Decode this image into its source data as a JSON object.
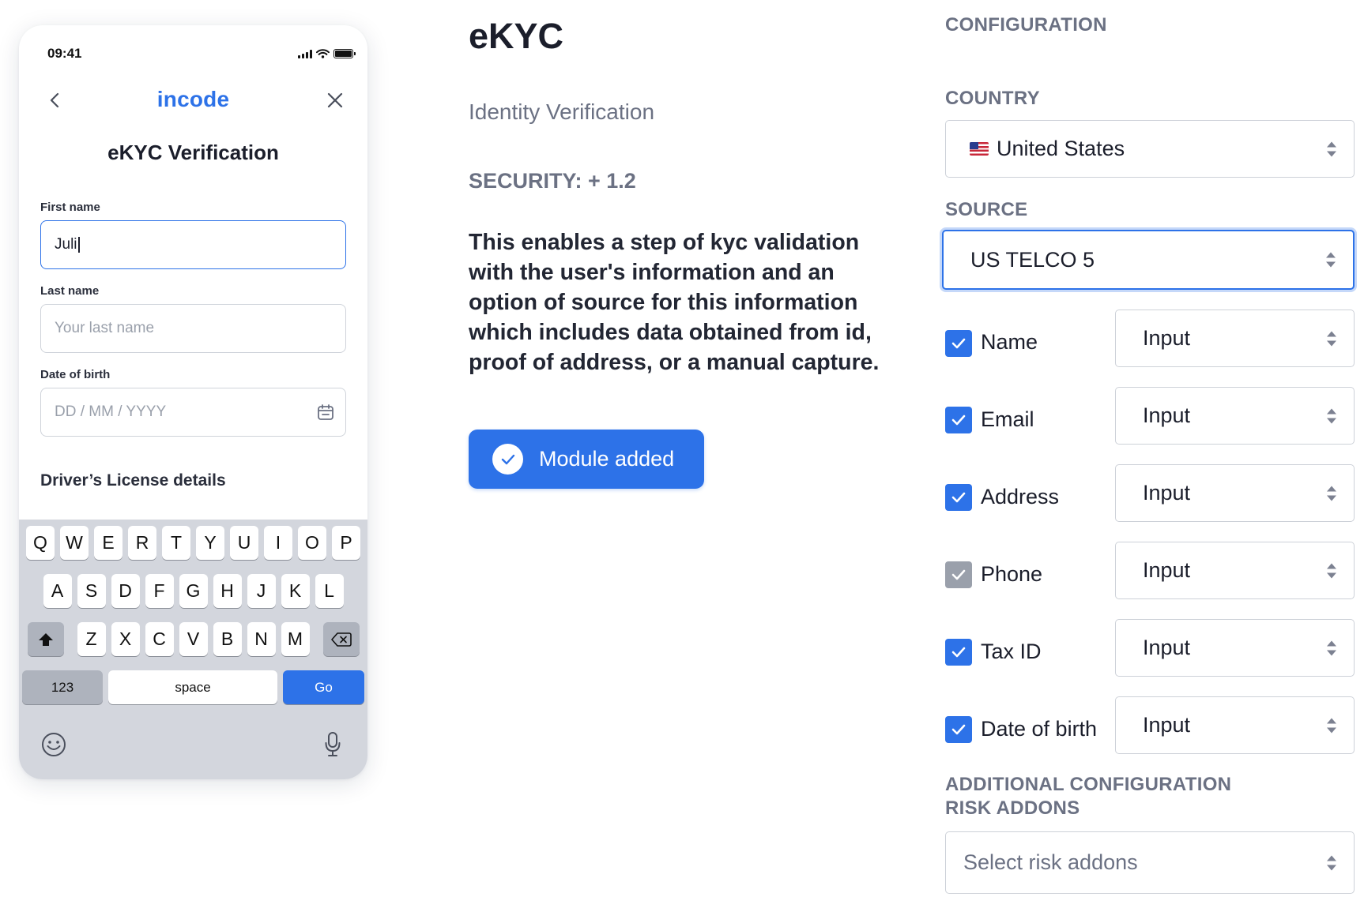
{
  "phone": {
    "status_time": "09:41",
    "brand": "incode",
    "title": "eKYC Verification",
    "first_name_label": "First name",
    "first_name_value": "Juli",
    "last_name_label": "Last name",
    "last_name_placeholder": "Your last name",
    "dob_label": "Date of birth",
    "dob_placeholder": "DD / MM / YYYY",
    "section_title": "Driver’s License details",
    "keyboard": {
      "row1": [
        "Q",
        "W",
        "E",
        "R",
        "T",
        "Y",
        "U",
        "I",
        "O",
        "P"
      ],
      "row2": [
        "A",
        "S",
        "D",
        "F",
        "G",
        "H",
        "J",
        "K",
        "L"
      ],
      "row3": [
        "Z",
        "X",
        "C",
        "V",
        "B",
        "N",
        "M"
      ],
      "num_key": "123",
      "space_key": "space",
      "go_key": "Go"
    }
  },
  "module": {
    "title": "eKYC",
    "subtitle": "Identity Verification",
    "security": "SECURITY: + 1.2",
    "description": "This enables a step of kyc validation with the user's information and an option of source for this information which includes data obtained from id, proof of address, or a manual capture.",
    "button_label": "Module added"
  },
  "config": {
    "heading": "CONFIGURATION",
    "country_label": "COUNTRY",
    "country_value": "United States",
    "source_label": "SOURCE",
    "source_value": "US TELCO 5",
    "fields": [
      {
        "label": "Name",
        "checked": true,
        "disabled": false,
        "mode": "Input"
      },
      {
        "label": "Email",
        "checked": true,
        "disabled": false,
        "mode": "Input"
      },
      {
        "label": "Address",
        "checked": true,
        "disabled": false,
        "mode": "Input"
      },
      {
        "label": "Phone",
        "checked": true,
        "disabled": true,
        "mode": "Input"
      },
      {
        "label": "Tax ID",
        "checked": true,
        "disabled": false,
        "mode": "Input"
      },
      {
        "label": "Date of birth",
        "checked": true,
        "disabled": false,
        "mode": "Input"
      }
    ],
    "additional_heading": "ADDITIONAL CONFIGURATION",
    "risk_label": "RISK ADDONS",
    "risk_placeholder": "Select risk addons"
  },
  "colors": {
    "accent": "#2d72e8",
    "muted_text": "#6b7183",
    "disabled_check": "#9aa0ab",
    "keyboard_bg": "#d3d6dd"
  }
}
